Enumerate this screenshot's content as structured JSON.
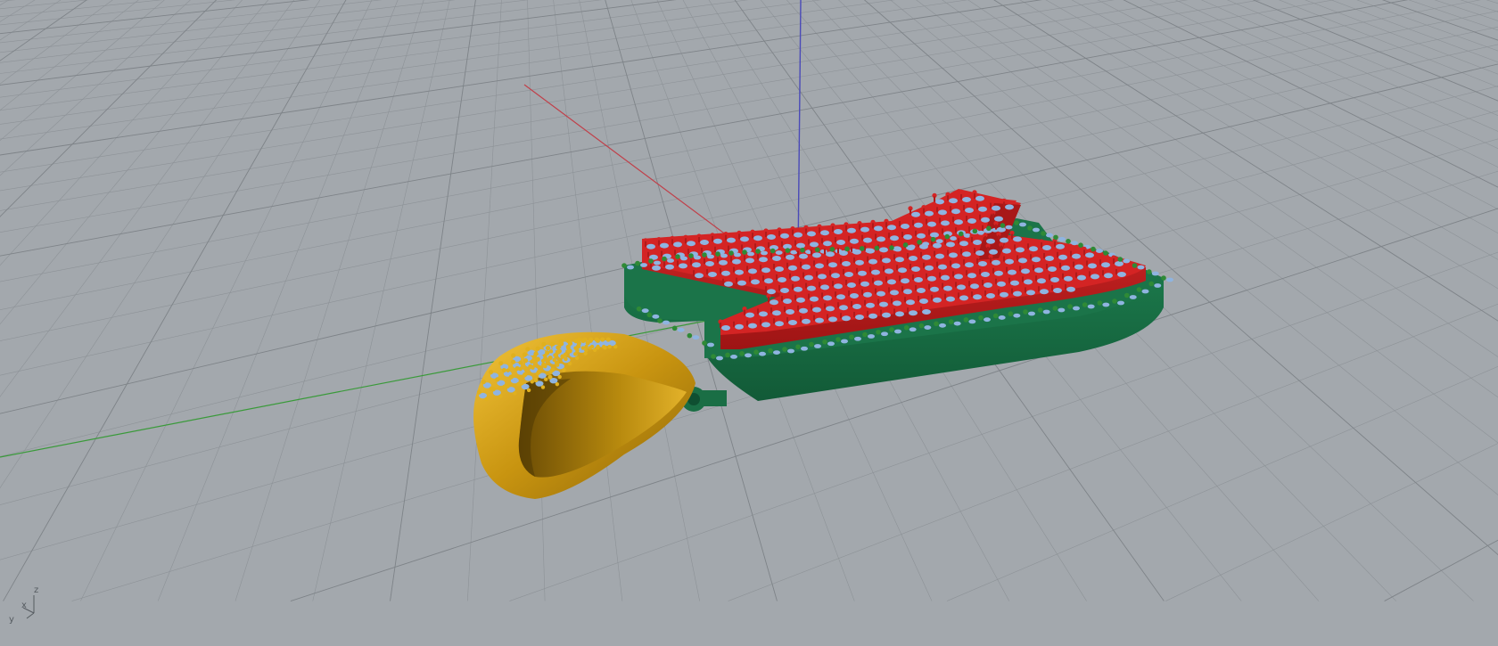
{
  "viewport": {
    "view_type": "perspective",
    "background_color": "#a3a8ad",
    "grid_color": "#8d9297",
    "grid_major_color": "#7e8388",
    "grid_visible": true,
    "world_axes": {
      "x_color": "#c0404a",
      "y_color": "#3a9a3a",
      "z_color": "#4a4ab8"
    },
    "axes_widget": {
      "z_label": "z",
      "x_label": "x",
      "y_label": "y"
    }
  },
  "model": {
    "objects": [
      {
        "name": "letter-top-layer",
        "color": "#d42424",
        "prong_color": "#d42424"
      },
      {
        "name": "letter-base-layer",
        "color": "#1e7a4e",
        "prong_color": "#2f8a36"
      },
      {
        "name": "bail-loop",
        "color": "#d4a015",
        "prong_color": "#e0b01e"
      },
      {
        "name": "gemstones",
        "color": "#8fb4e0"
      }
    ]
  }
}
